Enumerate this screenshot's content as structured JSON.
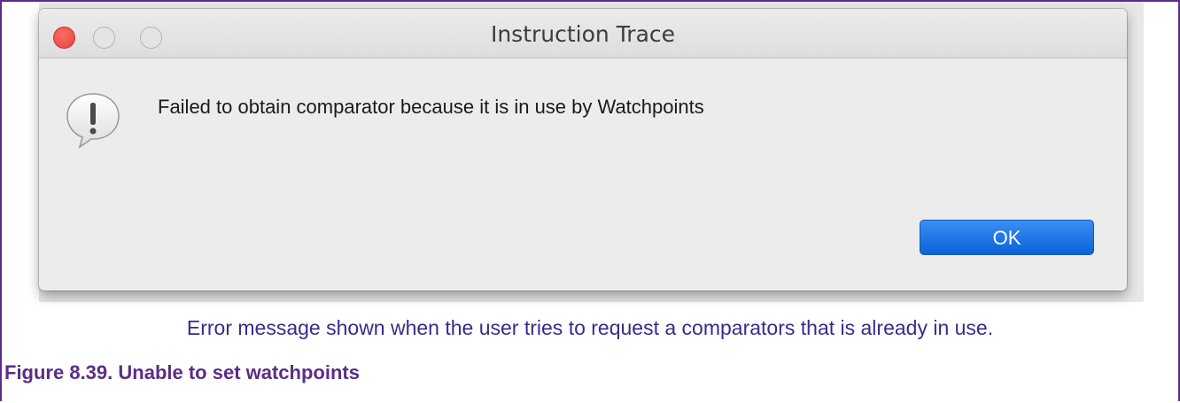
{
  "dialog": {
    "title": "Instruction Trace",
    "message": "Failed to obtain comparator because it is in use by Watchpoints",
    "ok_label": "OK",
    "icon": "alert-icon"
  },
  "figure": {
    "caption": "Error message shown when the user tries to request a comparators that is already in use.",
    "title": "Figure 8.39. Unable to set watchpoints"
  },
  "colors": {
    "border": "#5b2d86",
    "caption": "#3b2a8c",
    "ok_button": "#0a62d6",
    "close_button": "#e0443e"
  }
}
